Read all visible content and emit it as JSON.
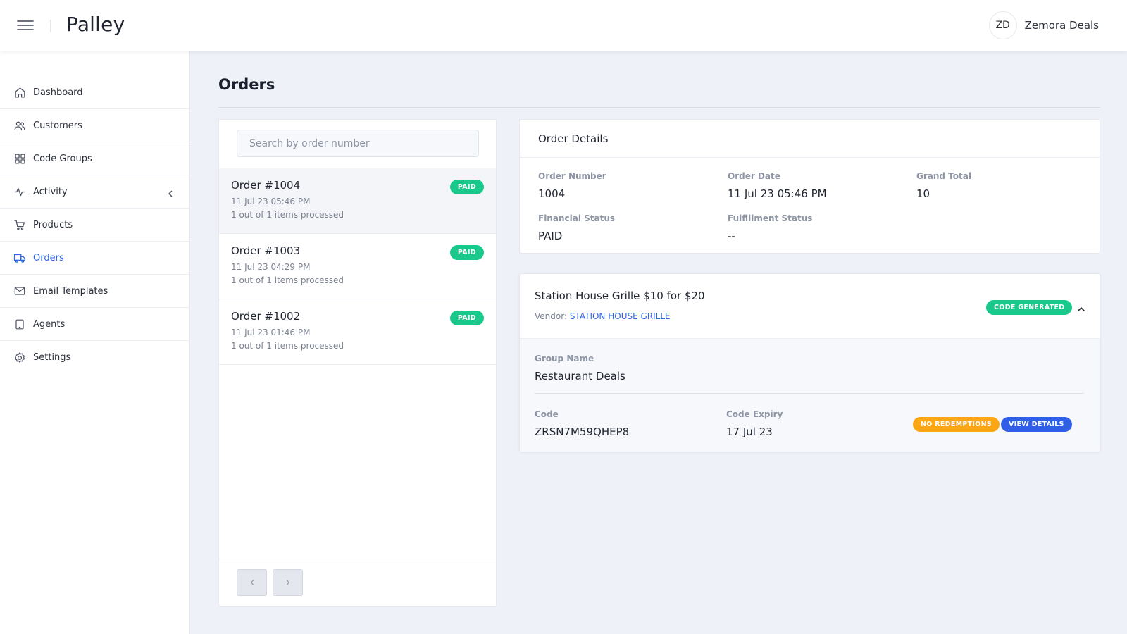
{
  "header": {
    "brand": "Palley",
    "user_initials": "ZD",
    "user_name": "Zemora Deals"
  },
  "sidebar": {
    "items": [
      {
        "label": "Dashboard",
        "icon": "home-icon"
      },
      {
        "label": "Customers",
        "icon": "users-icon"
      },
      {
        "label": "Code Groups",
        "icon": "grid-icon"
      },
      {
        "label": "Activity",
        "icon": "activity-icon"
      },
      {
        "label": "Products",
        "icon": "cart-icon"
      },
      {
        "label": "Orders",
        "icon": "truck-icon"
      },
      {
        "label": "Email Templates",
        "icon": "mail-icon"
      },
      {
        "label": "Agents",
        "icon": "tablet-icon"
      },
      {
        "label": "Settings",
        "icon": "gear-icon"
      }
    ],
    "active": "Orders"
  },
  "main": {
    "title": "Orders"
  },
  "order_list": {
    "search_placeholder": "Search by order number",
    "orders": [
      {
        "title": "Order #1004",
        "date": "11 Jul 23 05:46 PM",
        "processed": "1 out of 1 items processed",
        "status": "PAID"
      },
      {
        "title": "Order #1003",
        "date": "11 Jul 23 04:29 PM",
        "processed": "1 out of 1 items processed",
        "status": "PAID"
      },
      {
        "title": "Order #1002",
        "date": "11 Jul 23 01:46 PM",
        "processed": "1 out of 1 items processed",
        "status": "PAID"
      }
    ]
  },
  "details": {
    "header": "Order Details",
    "order_number_label": "Order Number",
    "order_number": "1004",
    "order_date_label": "Order Date",
    "order_date": "11 Jul 23 05:46 PM",
    "grand_total_label": "Grand Total",
    "grand_total": "10",
    "financial_status_label": "Financial Status",
    "financial_status": "PAID",
    "fulfillment_status_label": "Fulfillment Status",
    "fulfillment_status": "--"
  },
  "line_item": {
    "title": "Station House Grille $10 for $20",
    "vendor_label": "Vendor:",
    "vendor": "STATION HOUSE GRILLE",
    "code_status": "CODE GENERATED",
    "group_name_label": "Group Name",
    "group_name": "Restaurant Deals",
    "code_label": "Code",
    "code": "ZRSN7M59QHEP8",
    "code_expiry_label": "Code Expiry",
    "code_expiry": "17 Jul 23",
    "redemption_status": "NO REDEMPTIONS",
    "view_details_label": "VIEW DETAILS"
  },
  "colors": {
    "accent": "#2e66e8",
    "success": "#19c98b",
    "warning": "#fba614",
    "primary_button": "#2f5fe6"
  }
}
